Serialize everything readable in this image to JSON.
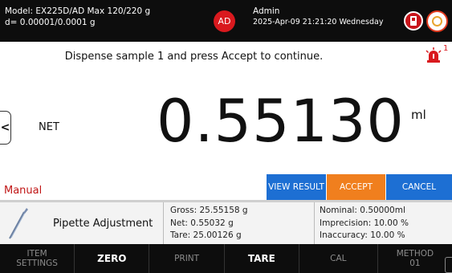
{
  "header": {
    "model_line": "Model: EX225D/AD   Max 120/220 g",
    "readability_line": "d= 0.00001/0.0001 g",
    "user_initials": "AD",
    "user_name": "Admin",
    "datetime": "2025-Apr-09 21:21:20 Wednesday",
    "usb_icon": "usb-drive-icon",
    "power_icon": "power-icon"
  },
  "main": {
    "instruction": "Dispense sample 1 and press Accept to continue.",
    "alarm_icon": "siren-alarm-icon",
    "alarm_count": "1",
    "side_handle_glyph": "<",
    "net_label": "NET",
    "reading": "0.55130",
    "unit": "ml",
    "mode": "Manual"
  },
  "actions": {
    "view_result": "VIEW RESULT",
    "accept": "ACCEPT",
    "cancel": "CANCEL"
  },
  "info": {
    "method_name": "Pipette Adjustment",
    "gross": "Gross: 25.55158  g",
    "net": "Net: 0.55032  g",
    "tare": "Tare: 25.00126  g",
    "nominal": "Nominal: 0.50000ml",
    "imprecision": "Imprecision: 10.00 %",
    "inaccuracy": "Inaccuracy: 10.00 %"
  },
  "toolbar": {
    "item_settings_1": "ITEM",
    "item_settings_2": "SETTINGS",
    "zero": "ZERO",
    "print": "PRINT",
    "tare": "TARE",
    "cal": "CAL",
    "method_1": "METHOD",
    "method_2": "01"
  },
  "colors": {
    "accent_blue": "#1d6fd3",
    "accept_orange": "#f07f1e",
    "alert_red": "#d9191e"
  }
}
